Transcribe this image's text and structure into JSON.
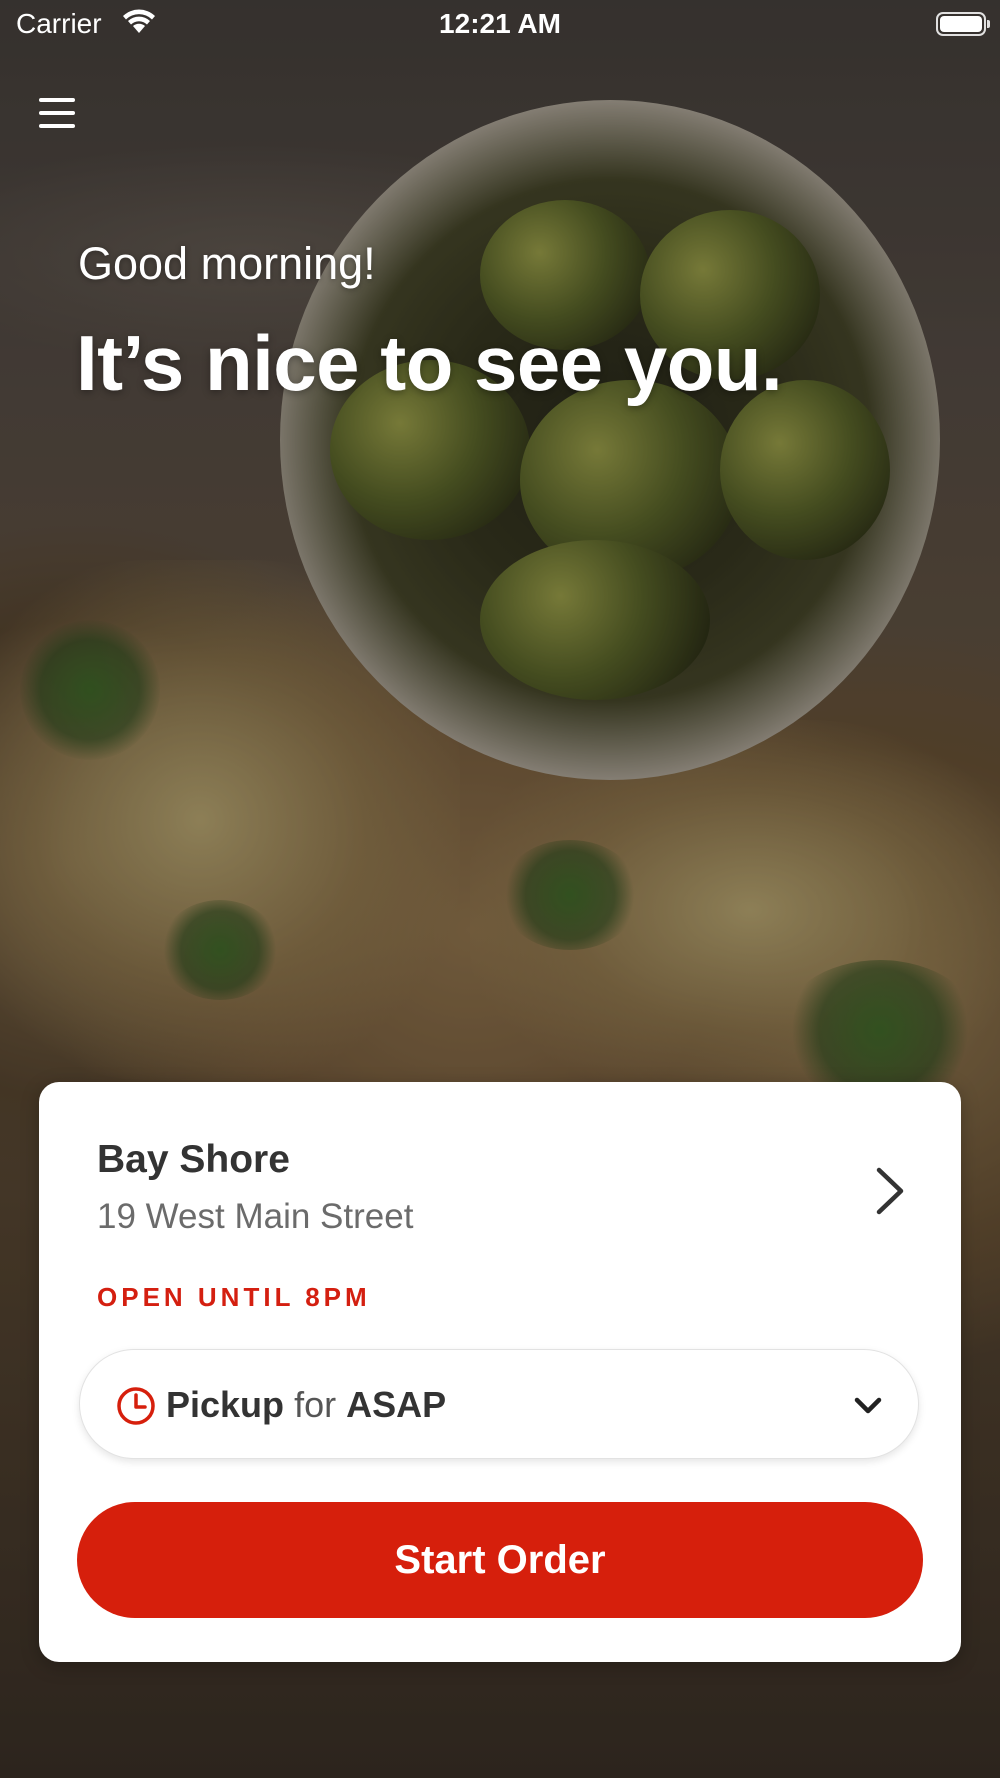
{
  "status_bar": {
    "carrier": "Carrier",
    "time": "12:21 AM",
    "battery_level": 1.0
  },
  "header": {
    "menu_icon": "hamburger-menu-icon",
    "greeting": "Good morning!",
    "headline": "It’s nice to see you."
  },
  "store": {
    "name": "Bay Shore",
    "address": "19 West Main Street",
    "hours": "OPEN UNTIL 8PM",
    "chevron_icon": "chevron-right-icon"
  },
  "order_mode": {
    "icon": "clock-icon",
    "mode": "Pickup",
    "connector": "for",
    "time": "ASAP",
    "dropdown_icon": "chevron-down-icon"
  },
  "actions": {
    "start_order": "Start Order"
  },
  "colors": {
    "accent": "#d61f0c",
    "hours_text": "#d41f10",
    "card_background": "#ffffff"
  }
}
